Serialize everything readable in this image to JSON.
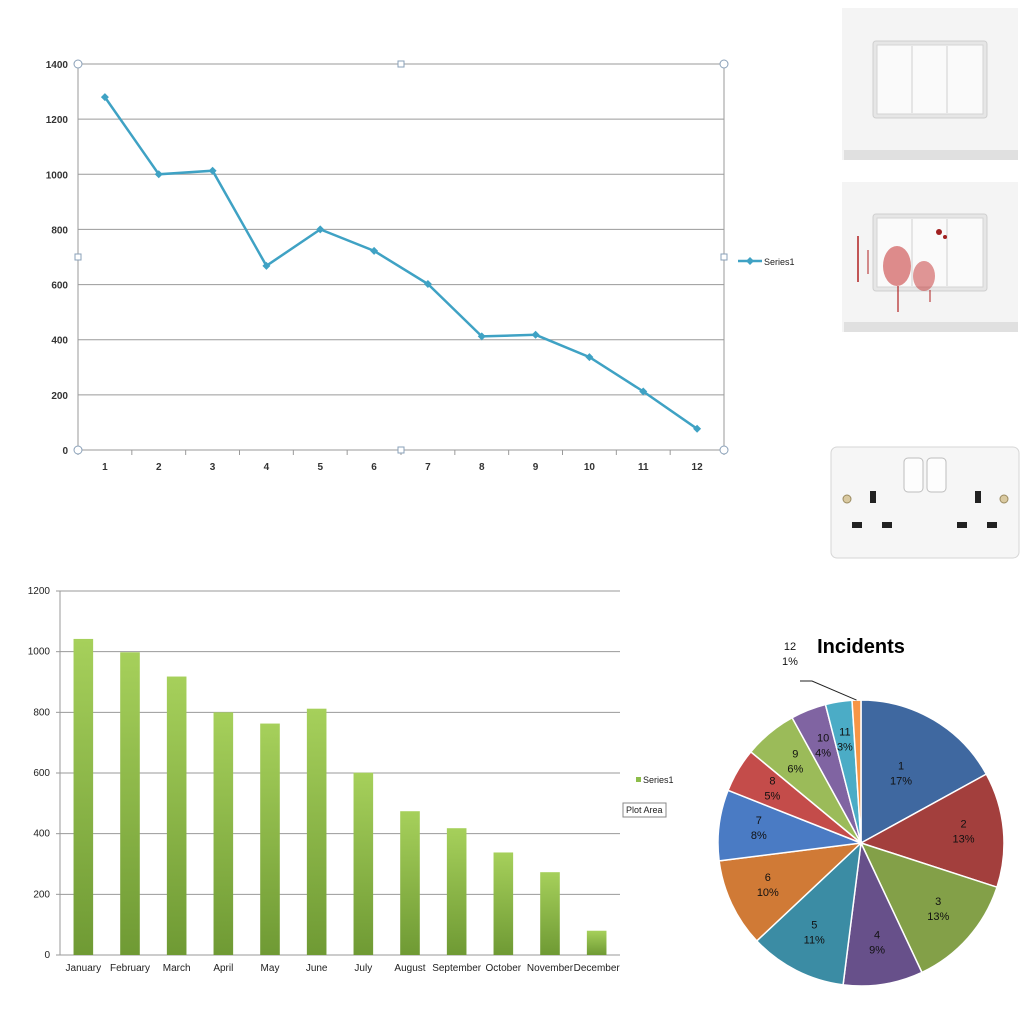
{
  "colors": {
    "line_series": "#3fa2c4",
    "bar_series": "#8dbd4a",
    "grid": "#9a9a9a"
  },
  "tooltip": {
    "text": "Plot Area"
  },
  "chart_data": [
    {
      "type": "line",
      "x": [
        1,
        2,
        3,
        4,
        5,
        6,
        7,
        8,
        9,
        10,
        11,
        12
      ],
      "series": [
        {
          "name": "Series1",
          "values": [
            1280,
            1000,
            1013,
            668,
            800,
            722,
            602,
            412,
            418,
            337,
            212,
            77
          ]
        }
      ],
      "yticks": [
        0,
        200,
        400,
        600,
        800,
        1000,
        1200,
        1400
      ],
      "ylim": [
        0,
        1400
      ],
      "grid": true,
      "legend": "right",
      "marker": "diamond"
    },
    {
      "type": "bar",
      "categories": [
        "January",
        "February",
        "March",
        "April",
        "May",
        "June",
        "July",
        "August",
        "September",
        "October",
        "November",
        "December"
      ],
      "series": [
        {
          "name": "Series1",
          "values": [
            1042,
            998,
            918,
            800,
            763,
            812,
            601,
            474,
            418,
            338,
            273,
            80
          ]
        }
      ],
      "yticks": [
        0,
        200,
        400,
        600,
        800,
        1000,
        1200
      ],
      "ylim": [
        0,
        1200
      ],
      "grid": true,
      "legend": "right"
    },
    {
      "type": "pie",
      "title": "Incidents",
      "categories": [
        "1",
        "2",
        "3",
        "4",
        "5",
        "6",
        "7",
        "8",
        "9",
        "10",
        "11",
        "12"
      ],
      "values": [
        17,
        13,
        13,
        9,
        11,
        10,
        8,
        5,
        6,
        4,
        3,
        1
      ],
      "percent_labels": [
        "17%",
        "13%",
        "13%",
        "9%",
        "11%",
        "10%",
        "8%",
        "5%",
        "6%",
        "4%",
        "3%",
        "1%"
      ],
      "colors": [
        "#3f68a0",
        "#a33f3d",
        "#83a048",
        "#67508a",
        "#3b8ca4",
        "#d07a36",
        "#4a7bc4",
        "#c44c4a",
        "#9bbb59",
        "#8064a2",
        "#4bacc6",
        "#f79646"
      ]
    }
  ]
}
